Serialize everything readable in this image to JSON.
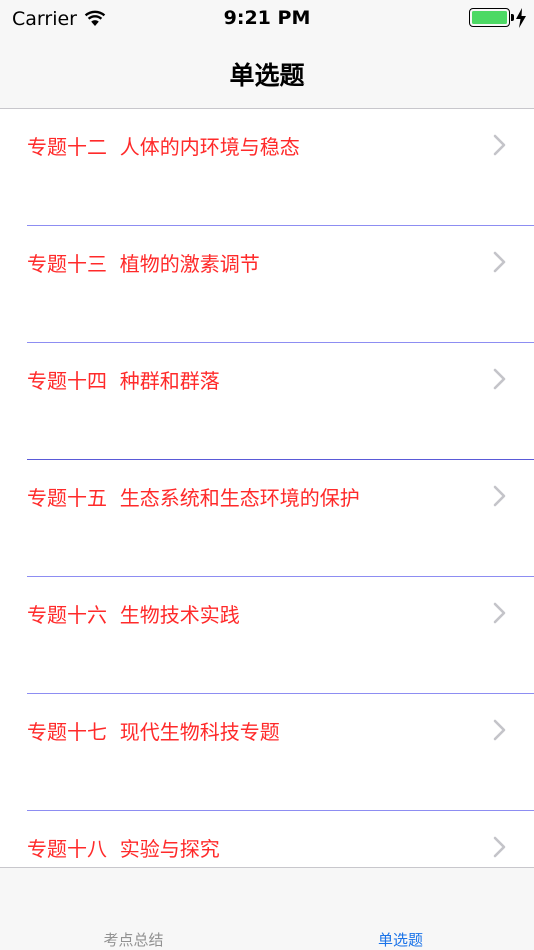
{
  "status_bar": {
    "carrier": "Carrier",
    "time": "9:21 PM",
    "battery_level": 1.0,
    "battery_color": "#4cd964"
  },
  "nav": {
    "title": "单选题"
  },
  "list": {
    "label_color": "#ff2a2a",
    "items": [
      {
        "label": "专题十二  人体的内环境与稳态"
      },
      {
        "label": "专题十三  植物的激素调节"
      },
      {
        "label": "专题十四  种群和群落"
      },
      {
        "label": "专题十五  生态系统和生态环境的保护"
      },
      {
        "label": "专题十六  生物技术实践"
      },
      {
        "label": "专题十七  现代生物科技专题"
      },
      {
        "label": "专题十八  实验与探究"
      }
    ]
  },
  "tabs": [
    {
      "label": "考点总结",
      "active": false
    },
    {
      "label": "单选题",
      "active": true
    }
  ],
  "accent_color": "#1a73e8"
}
